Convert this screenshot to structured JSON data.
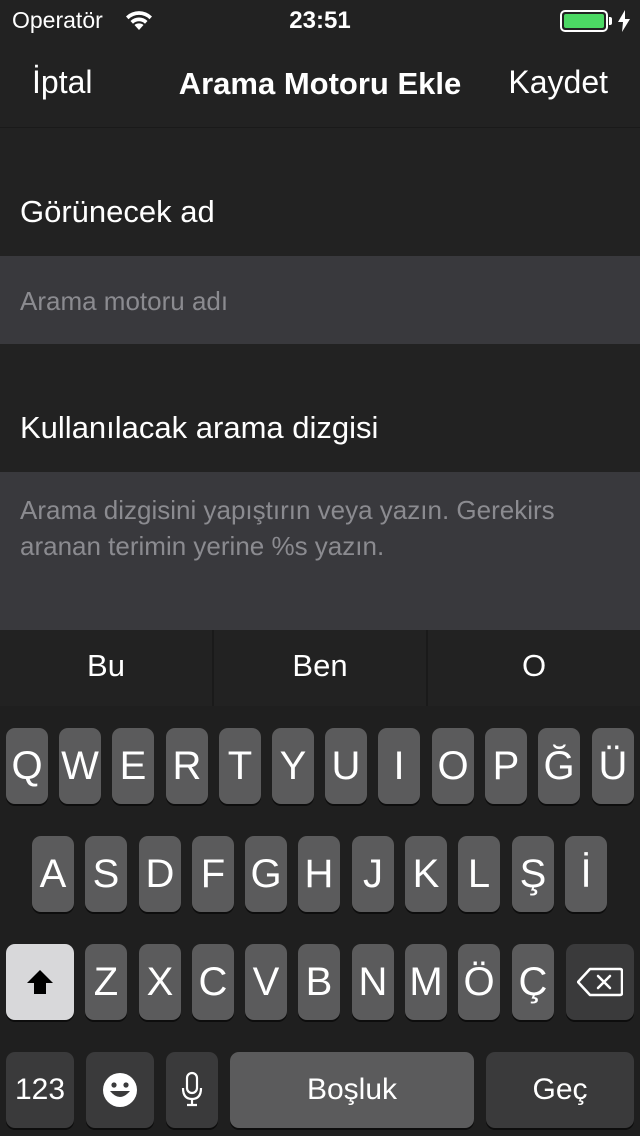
{
  "status_bar": {
    "carrier": "Operatör",
    "time": "23:51",
    "wifi_icon": "wifi-icon",
    "battery_level": 1.0,
    "battery_color": "#4cd964",
    "charging_icon": "charging-bolt-icon"
  },
  "nav": {
    "cancel_label": "İptal",
    "title": "Arama Motoru Ekle",
    "save_label": "Kaydet"
  },
  "form": {
    "name_section_label": "Görünecek ad",
    "name_placeholder": "Arama motoru adı",
    "search_string_section_label": "Kullanılacak arama dizgisi",
    "search_string_placeholder_line1": "Arama dizgisini yapıştırın veya yazın. Gerekirs",
    "search_string_placeholder_line2": "aranan terimin yerine %s yazın."
  },
  "suggestions": [
    "Bu",
    "Ben",
    "O"
  ],
  "keyboard": {
    "row1": [
      "Q",
      "W",
      "E",
      "R",
      "T",
      "Y",
      "U",
      "I",
      "O",
      "P",
      "Ğ",
      "Ü"
    ],
    "row2": [
      "A",
      "S",
      "D",
      "F",
      "G",
      "H",
      "J",
      "K",
      "L",
      "Ş",
      "İ"
    ],
    "row3": [
      "Z",
      "X",
      "C",
      "V",
      "B",
      "N",
      "M",
      "Ö",
      "Ç"
    ],
    "numbers_label": "123",
    "space_label": "Boşluk",
    "return_label": "Geç",
    "shift_icon": "shift-icon",
    "delete_icon": "backspace-icon",
    "emoji_icon": "emoji-icon",
    "mic_icon": "microphone-icon"
  },
  "colors": {
    "background": "#222222",
    "field_background": "#39393d",
    "placeholder": "#8b8b90",
    "key": "#5b5b5c",
    "key_dark": "#3a3a3b",
    "shift_active": "#d8d8da"
  }
}
